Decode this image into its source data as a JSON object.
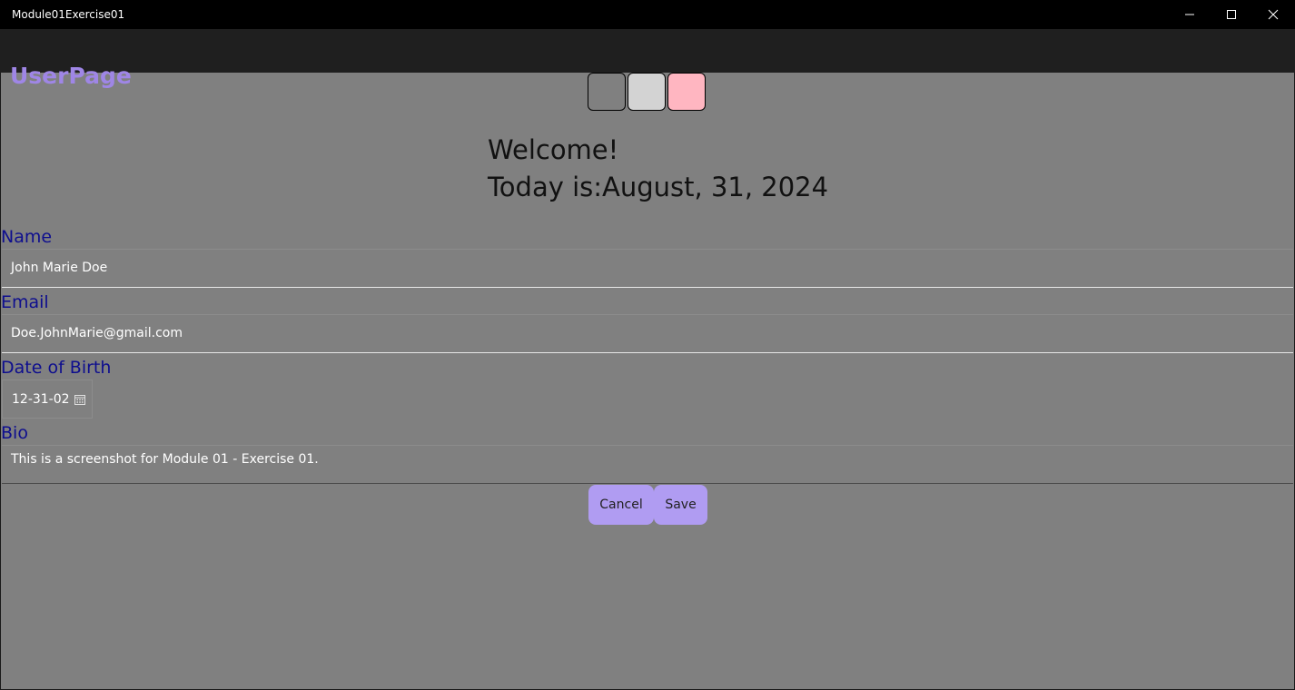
{
  "window": {
    "title": "Module01Exercise01"
  },
  "header": {
    "title": "UserPage",
    "title_color": "#9f86e6"
  },
  "swatches": [
    {
      "name": "gray",
      "color": "#808080"
    },
    {
      "name": "lightgray",
      "color": "#d3d3d3"
    },
    {
      "name": "pink",
      "color": "#ffb6c1"
    }
  ],
  "greeting": {
    "welcome": "Welcome!",
    "today": "Today is:August, 31, 2024"
  },
  "form": {
    "name_label": "Name",
    "name_value": "John Marie Doe",
    "email_label": "Email",
    "email_value": "Doe.JohnMarie@gmail.com",
    "dob_label": "Date of Birth",
    "dob_value": "12-31-02",
    "bio_label": "Bio",
    "bio_value": "This is a screenshot for Module 01 - Exercise 01."
  },
  "buttons": {
    "cancel": "Cancel",
    "save": "Save",
    "color": "#b09cf2"
  },
  "colors": {
    "page_background": "#808080",
    "label_color": "#0e0e8e"
  }
}
